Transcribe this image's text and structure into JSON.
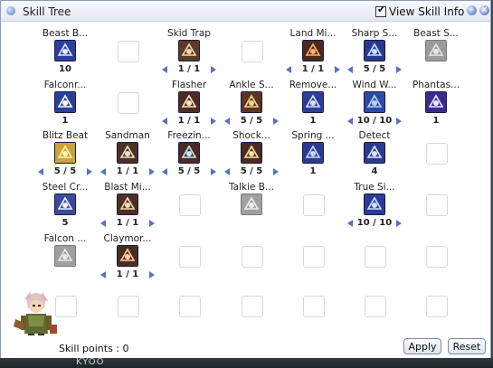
{
  "window": {
    "title": "Skill Tree",
    "view_skill_info_label": "View Skill Info",
    "view_skill_info_checked": true
  },
  "footer": {
    "skill_points_label": "Skill points : 0",
    "apply_label": "Apply",
    "reset_label": "Reset"
  },
  "background": {
    "text": "KYOO"
  },
  "skills": [
    {
      "name": "Beast B...",
      "level": "10",
      "row": 0,
      "col": 0,
      "icon": "beast-bane-icon",
      "adjustable": false,
      "learned": true
    },
    {
      "name": "Skid Trap",
      "level": "1 / 1",
      "row": 0,
      "col": 2,
      "icon": "skid-trap-icon",
      "adjustable": true,
      "learned": true
    },
    {
      "name": "Land Mi...",
      "level": "1 / 1",
      "row": 0,
      "col": 4,
      "icon": "land-mine-icon",
      "adjustable": true,
      "learned": true
    },
    {
      "name": "Sharp S...",
      "level": "5 / 5",
      "row": 0,
      "col": 5,
      "icon": "sharp-shooting-icon",
      "adjustable": true,
      "learned": true
    },
    {
      "name": "Beast S...",
      "level": "",
      "row": 0,
      "col": 6,
      "icon": "beast-strafing-icon",
      "adjustable": false,
      "learned": false
    },
    {
      "name": "Falconr...",
      "level": "1",
      "row": 1,
      "col": 0,
      "icon": "falconry-icon",
      "adjustable": false,
      "learned": true
    },
    {
      "name": "Flasher",
      "level": "1 / 1",
      "row": 1,
      "col": 2,
      "icon": "flasher-icon",
      "adjustable": true,
      "learned": true
    },
    {
      "name": "Ankle S...",
      "level": "5 / 5",
      "row": 1,
      "col": 3,
      "icon": "ankle-snare-icon",
      "adjustable": true,
      "learned": true
    },
    {
      "name": "Remove...",
      "level": "1",
      "row": 1,
      "col": 4,
      "icon": "remove-trap-icon",
      "adjustable": false,
      "learned": true
    },
    {
      "name": "Wind W...",
      "level": "10 / 10",
      "row": 1,
      "col": 5,
      "icon": "wind-walk-icon",
      "adjustable": true,
      "learned": true
    },
    {
      "name": "Phantas...",
      "level": "1",
      "row": 1,
      "col": 6,
      "icon": "phantasmic-arrow-icon",
      "adjustable": false,
      "learned": true
    },
    {
      "name": "Blitz Beat",
      "level": "5 / 5",
      "row": 2,
      "col": 0,
      "icon": "blitz-beat-icon",
      "adjustable": true,
      "learned": true
    },
    {
      "name": "Sandman",
      "level": "1 / 1",
      "row": 2,
      "col": 1,
      "icon": "sandman-icon",
      "adjustable": true,
      "learned": true
    },
    {
      "name": "Freezin...",
      "level": "5 / 5",
      "row": 2,
      "col": 2,
      "icon": "freezing-trap-icon",
      "adjustable": true,
      "learned": true
    },
    {
      "name": "Shock...",
      "level": "5 / 5",
      "row": 2,
      "col": 3,
      "icon": "shockwave-trap-icon",
      "adjustable": true,
      "learned": true
    },
    {
      "name": "Spring ...",
      "level": "1",
      "row": 2,
      "col": 4,
      "icon": "spring-trap-icon",
      "adjustable": false,
      "learned": true
    },
    {
      "name": "Detect",
      "level": "4",
      "row": 2,
      "col": 5,
      "icon": "detect-icon",
      "adjustable": false,
      "learned": true
    },
    {
      "name": "Steel Cr...",
      "level": "5",
      "row": 3,
      "col": 0,
      "icon": "steel-crow-icon",
      "adjustable": false,
      "learned": true
    },
    {
      "name": "Blast Mi...",
      "level": "1 / 1",
      "row": 3,
      "col": 1,
      "icon": "blast-mine-icon",
      "adjustable": true,
      "learned": true
    },
    {
      "name": "Talkie B...",
      "level": "",
      "row": 3,
      "col": 3,
      "icon": "talkie-box-icon",
      "adjustable": false,
      "learned": false
    },
    {
      "name": "True Si...",
      "level": "10 / 10",
      "row": 3,
      "col": 5,
      "icon": "true-sight-icon",
      "adjustable": true,
      "learned": true
    },
    {
      "name": "Falcon ...",
      "level": "",
      "row": 4,
      "col": 0,
      "icon": "falcon-assault-icon",
      "adjustable": false,
      "learned": false
    },
    {
      "name": "Claymor...",
      "level": "1 / 1",
      "row": 4,
      "col": 1,
      "icon": "claymore-trap-icon",
      "adjustable": true,
      "learned": true
    }
  ],
  "empty_slots": [
    {
      "row": 0,
      "col": 1
    },
    {
      "row": 0,
      "col": 3
    },
    {
      "row": 1,
      "col": 1
    },
    {
      "row": 2,
      "col": 6
    },
    {
      "row": 3,
      "col": 2
    },
    {
      "row": 3,
      "col": 4
    },
    {
      "row": 3,
      "col": 6
    },
    {
      "row": 4,
      "col": 2
    },
    {
      "row": 4,
      "col": 3
    },
    {
      "row": 4,
      "col": 4
    },
    {
      "row": 4,
      "col": 5
    },
    {
      "row": 4,
      "col": 6
    },
    {
      "row": 5,
      "col": 0
    },
    {
      "row": 5,
      "col": 1
    },
    {
      "row": 5,
      "col": 2
    },
    {
      "row": 5,
      "col": 3
    },
    {
      "row": 5,
      "col": 4
    },
    {
      "row": 5,
      "col": 5
    },
    {
      "row": 5,
      "col": 6
    }
  ],
  "colors": {
    "accent": "#5870c8",
    "window_border": "#8c9bb5",
    "title_bar": "#e3e8f2"
  }
}
